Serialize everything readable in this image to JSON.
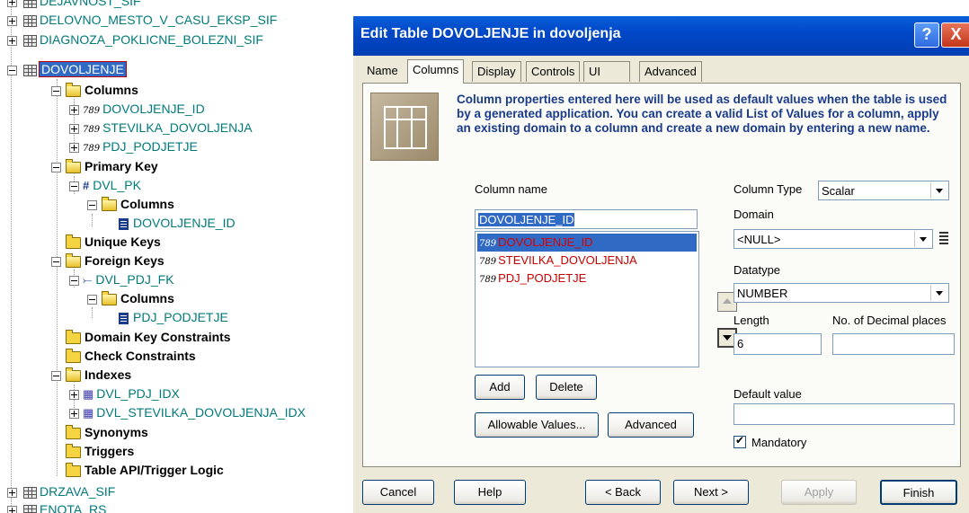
{
  "tree": {
    "items": [
      {
        "label": "DEJAVNOST_SIF"
      },
      {
        "label": "DELOVNO_MESTO_V_CASU_EKSP_SIF"
      },
      {
        "label": "DIAGNOZA_POKLICNE_BOLEZNI_SIF"
      },
      {
        "label": "DOVOLJENJE"
      },
      {
        "label": "Columns"
      },
      {
        "label": "DOVOLJENJE_ID"
      },
      {
        "label": "STEVILKA_DOVOLJENJA"
      },
      {
        "label": "PDJ_PODJETJE"
      },
      {
        "label": "Primary Key"
      },
      {
        "label": "DVL_PK"
      },
      {
        "label": "Columns"
      },
      {
        "label": "DOVOLJENJE_ID"
      },
      {
        "label": "Unique Keys"
      },
      {
        "label": "Foreign Keys"
      },
      {
        "label": "DVL_PDJ_FK"
      },
      {
        "label": "Columns"
      },
      {
        "label": "PDJ_PODJETJE"
      },
      {
        "label": "Domain Key Constraints"
      },
      {
        "label": "Check Constraints"
      },
      {
        "label": "Indexes"
      },
      {
        "label": "DVL_PDJ_IDX"
      },
      {
        "label": "DVL_STEVILKA_DOVOLJENJA_IDX"
      },
      {
        "label": "Synonyms"
      },
      {
        "label": "Triggers"
      },
      {
        "label": "Table API/Trigger Logic"
      },
      {
        "label": "DRZAVA_SIF"
      },
      {
        "label": "ENOTA_RS"
      }
    ],
    "column_type_glyph": "789"
  },
  "dialog": {
    "title": "Edit Table DOVOLJENJE in dovoljenja",
    "help_glyph": "?",
    "close_glyph": "X",
    "tabs": [
      "Name",
      "Columns",
      "Display",
      "Controls",
      "UI",
      "Advanced"
    ],
    "active_tab": "Columns",
    "banner": "Column properties entered here will be used as default values when the table is used by a generated application. You can create a valid List of Values for a column, apply an existing domain to a column and create a new domain by entering a new name.",
    "column_name_label": "Column name",
    "column_name_value": "DOVOLJENJE_ID",
    "columns": [
      "DOVOLJENJE_ID",
      "STEVILKA_DOVOLJENJA",
      "PDJ_PODJETJE"
    ],
    "add_label": "Add",
    "delete_label": "Delete",
    "allowable_values_label": "Allowable Values...",
    "advanced_label": "Advanced",
    "column_type_label": "Column Type",
    "column_type_value": "Scalar",
    "domain_label": "Domain",
    "domain_value": "<NULL>",
    "datatype_label": "Datatype",
    "datatype_value": "NUMBER",
    "length_label": "Length",
    "length_value": "6",
    "decimal_label": "No. of Decimal places",
    "decimal_value": "",
    "default_label": "Default value",
    "default_value": "",
    "mandatory_label": "Mandatory",
    "mandatory_checked": true,
    "footer": {
      "cancel": "Cancel",
      "help": "Help",
      "back": "< Back",
      "next": "Next >",
      "apply": "Apply",
      "finish": "Finish"
    }
  }
}
